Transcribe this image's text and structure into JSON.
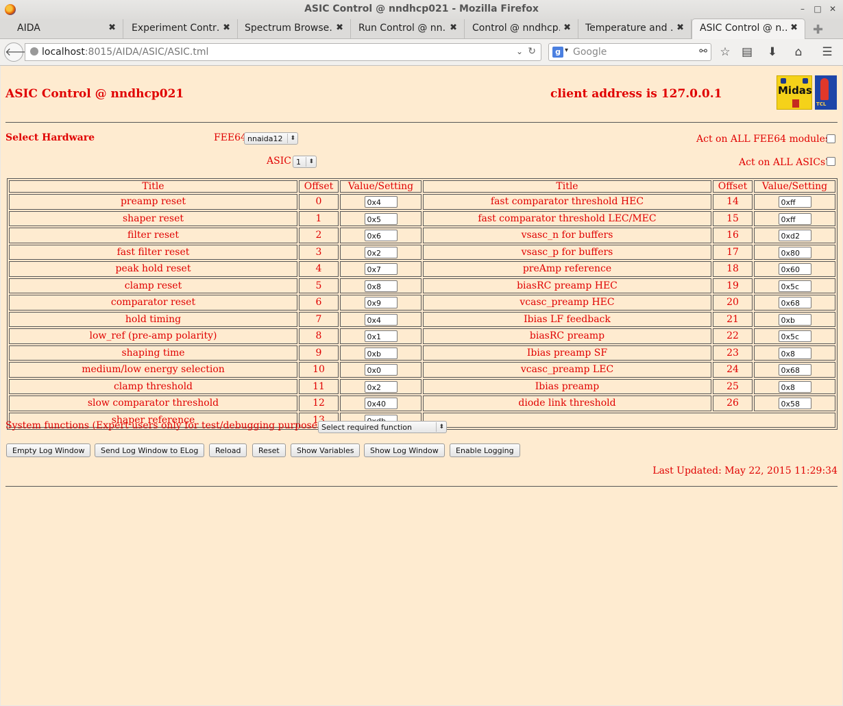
{
  "window": {
    "title": "ASIC Control @ nndhcp021 - Mozilla Firefox"
  },
  "tabs": [
    {
      "label": "AIDA"
    },
    {
      "label": "Experiment Contr…"
    },
    {
      "label": "Spectrum Browse…"
    },
    {
      "label": "Run Control @ nn…"
    },
    {
      "label": "Control @ nndhcp…"
    },
    {
      "label": "Temperature and …"
    },
    {
      "label": "ASIC Control @ n…"
    }
  ],
  "nav": {
    "url_host": "localhost",
    "url_rest": ":8015/AIDA/ASIC/ASIC.tml",
    "search_placeholder": "Google"
  },
  "page": {
    "heading": "ASIC Control @ nndhcp021",
    "client": "client address is 127.0.0.1",
    "select_hardware": "Select Hardware",
    "fee64_label": "FEE64",
    "fee64_value": "nnaida12",
    "asic_label": "ASIC",
    "asic_value": "1",
    "act_all_fee": "Act on ALL FEE64 modules?",
    "act_all_asic": "Act on ALL ASICs?",
    "col_title": "Title",
    "col_offset": "Offset",
    "col_value": "Value/Setting",
    "left_rows": [
      {
        "title": "preamp reset",
        "offset": "0",
        "value": "0x4"
      },
      {
        "title": "shaper reset",
        "offset": "1",
        "value": "0x5"
      },
      {
        "title": "filter reset",
        "offset": "2",
        "value": "0x6"
      },
      {
        "title": "fast filter reset",
        "offset": "3",
        "value": "0x2"
      },
      {
        "title": "peak hold reset",
        "offset": "4",
        "value": "0x7"
      },
      {
        "title": "clamp reset",
        "offset": "5",
        "value": "0x8"
      },
      {
        "title": "comparator reset",
        "offset": "6",
        "value": "0x9"
      },
      {
        "title": "hold timing",
        "offset": "7",
        "value": "0x4"
      },
      {
        "title": "low_ref (pre-amp polarity)",
        "offset": "8",
        "value": "0x1"
      },
      {
        "title": "shaping time",
        "offset": "9",
        "value": "0xb"
      },
      {
        "title": "medium/low energy selection",
        "offset": "10",
        "value": "0x0"
      },
      {
        "title": "clamp threshold",
        "offset": "11",
        "value": "0x2"
      },
      {
        "title": "slow comparator threshold",
        "offset": "12",
        "value": "0x40"
      },
      {
        "title": "shaper reference",
        "offset": "13",
        "value": "0xdb"
      }
    ],
    "right_rows": [
      {
        "title": "fast comparator threshold HEC",
        "offset": "14",
        "value": "0xff"
      },
      {
        "title": "fast comparator threshold LEC/MEC",
        "offset": "15",
        "value": "0xff"
      },
      {
        "title": "vsasc_n for buffers",
        "offset": "16",
        "value": "0xd2"
      },
      {
        "title": "vsasc_p for buffers",
        "offset": "17",
        "value": "0x80"
      },
      {
        "title": "preAmp reference",
        "offset": "18",
        "value": "0x60"
      },
      {
        "title": "biasRC preamp HEC",
        "offset": "19",
        "value": "0x5c"
      },
      {
        "title": "vcasc_preamp HEC",
        "offset": "20",
        "value": "0x68"
      },
      {
        "title": "Ibias LF feedback",
        "offset": "21",
        "value": "0xb"
      },
      {
        "title": "biasRC preamp",
        "offset": "22",
        "value": "0x5c"
      },
      {
        "title": "Ibias preamp SF",
        "offset": "23",
        "value": "0x8"
      },
      {
        "title": "vcasc_preamp LEC",
        "offset": "24",
        "value": "0x68"
      },
      {
        "title": "Ibias preamp",
        "offset": "25",
        "value": "0x8"
      },
      {
        "title": "diode link threshold",
        "offset": "26",
        "value": "0x58"
      }
    ],
    "system_functions": "System functions (Expert users only for test/debugging purposes!!!)",
    "system_select": "Select required function",
    "buttons": [
      "Empty Log Window",
      "Send Log Window to ELog",
      "Reload",
      "Reset",
      "Show Variables",
      "Show Log Window",
      "Enable Logging"
    ],
    "last_updated": "Last Updated: May 22, 2015 11:29:34"
  }
}
